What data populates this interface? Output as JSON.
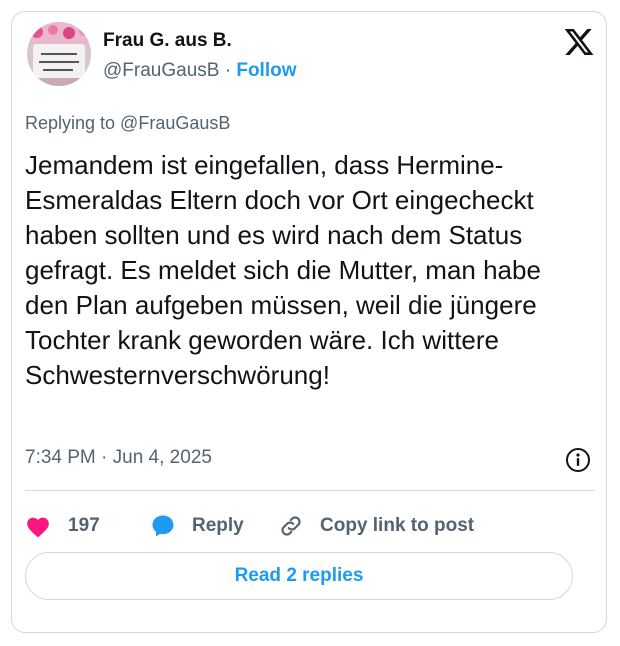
{
  "author": {
    "name": "Frau G. aus B.",
    "handle": "@FrauGausB",
    "separator": "·",
    "follow_label": "Follow"
  },
  "replying_to": "Replying to @FrauGausB",
  "tweet_text": "Jemandem ist eingefallen, dass Hermine-Esmeraldas Eltern doch vor Ort eingecheckt haben sollten und es wird nach dem Status gefragt. Es meldet sich die Mutter, man habe den Plan aufgeben müssen, weil die jüngere Tochter krank geworden wäre. Ich wittere Schwesternverschwörung!",
  "timestamp": "7:34 PM · Jun 4, 2025",
  "actions": {
    "like_count": "197",
    "reply_label": "Reply",
    "copy_label": "Copy link to post"
  },
  "read_replies_label": "Read 2 replies",
  "colors": {
    "accent": "#1d9bf0",
    "like": "#f91880",
    "text": "#0f1419",
    "muted": "#536471",
    "border": "#cfd9de"
  },
  "icons": [
    "x-logo-icon",
    "info-icon",
    "heart-icon",
    "reply-bubble-icon",
    "link-icon"
  ]
}
